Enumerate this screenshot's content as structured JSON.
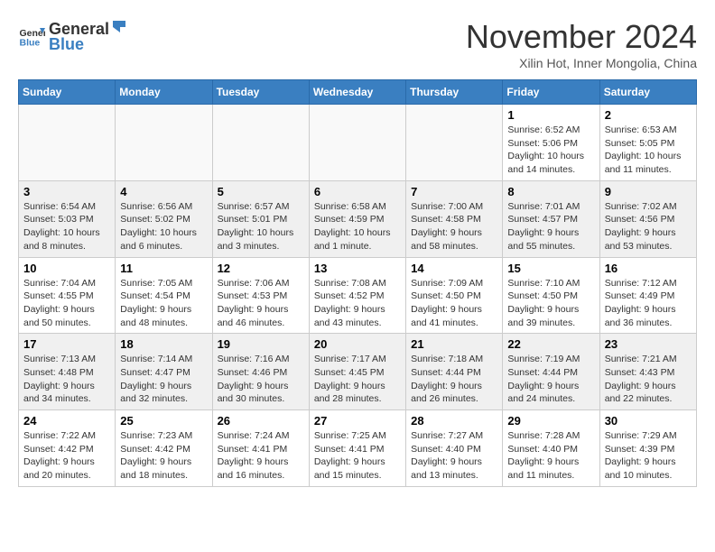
{
  "logo": {
    "text_general": "General",
    "text_blue": "Blue"
  },
  "title": "November 2024",
  "subtitle": "Xilin Hot, Inner Mongolia, China",
  "days_of_week": [
    "Sunday",
    "Monday",
    "Tuesday",
    "Wednesday",
    "Thursday",
    "Friday",
    "Saturday"
  ],
  "weeks": [
    [
      {
        "day": "",
        "info": ""
      },
      {
        "day": "",
        "info": ""
      },
      {
        "day": "",
        "info": ""
      },
      {
        "day": "",
        "info": ""
      },
      {
        "day": "",
        "info": ""
      },
      {
        "day": "1",
        "info": "Sunrise: 6:52 AM\nSunset: 5:06 PM\nDaylight: 10 hours and 14 minutes."
      },
      {
        "day": "2",
        "info": "Sunrise: 6:53 AM\nSunset: 5:05 PM\nDaylight: 10 hours and 11 minutes."
      }
    ],
    [
      {
        "day": "3",
        "info": "Sunrise: 6:54 AM\nSunset: 5:03 PM\nDaylight: 10 hours and 8 minutes."
      },
      {
        "day": "4",
        "info": "Sunrise: 6:56 AM\nSunset: 5:02 PM\nDaylight: 10 hours and 6 minutes."
      },
      {
        "day": "5",
        "info": "Sunrise: 6:57 AM\nSunset: 5:01 PM\nDaylight: 10 hours and 3 minutes."
      },
      {
        "day": "6",
        "info": "Sunrise: 6:58 AM\nSunset: 4:59 PM\nDaylight: 10 hours and 1 minute."
      },
      {
        "day": "7",
        "info": "Sunrise: 7:00 AM\nSunset: 4:58 PM\nDaylight: 9 hours and 58 minutes."
      },
      {
        "day": "8",
        "info": "Sunrise: 7:01 AM\nSunset: 4:57 PM\nDaylight: 9 hours and 55 minutes."
      },
      {
        "day": "9",
        "info": "Sunrise: 7:02 AM\nSunset: 4:56 PM\nDaylight: 9 hours and 53 minutes."
      }
    ],
    [
      {
        "day": "10",
        "info": "Sunrise: 7:04 AM\nSunset: 4:55 PM\nDaylight: 9 hours and 50 minutes."
      },
      {
        "day": "11",
        "info": "Sunrise: 7:05 AM\nSunset: 4:54 PM\nDaylight: 9 hours and 48 minutes."
      },
      {
        "day": "12",
        "info": "Sunrise: 7:06 AM\nSunset: 4:53 PM\nDaylight: 9 hours and 46 minutes."
      },
      {
        "day": "13",
        "info": "Sunrise: 7:08 AM\nSunset: 4:52 PM\nDaylight: 9 hours and 43 minutes."
      },
      {
        "day": "14",
        "info": "Sunrise: 7:09 AM\nSunset: 4:50 PM\nDaylight: 9 hours and 41 minutes."
      },
      {
        "day": "15",
        "info": "Sunrise: 7:10 AM\nSunset: 4:50 PM\nDaylight: 9 hours and 39 minutes."
      },
      {
        "day": "16",
        "info": "Sunrise: 7:12 AM\nSunset: 4:49 PM\nDaylight: 9 hours and 36 minutes."
      }
    ],
    [
      {
        "day": "17",
        "info": "Sunrise: 7:13 AM\nSunset: 4:48 PM\nDaylight: 9 hours and 34 minutes."
      },
      {
        "day": "18",
        "info": "Sunrise: 7:14 AM\nSunset: 4:47 PM\nDaylight: 9 hours and 32 minutes."
      },
      {
        "day": "19",
        "info": "Sunrise: 7:16 AM\nSunset: 4:46 PM\nDaylight: 9 hours and 30 minutes."
      },
      {
        "day": "20",
        "info": "Sunrise: 7:17 AM\nSunset: 4:45 PM\nDaylight: 9 hours and 28 minutes."
      },
      {
        "day": "21",
        "info": "Sunrise: 7:18 AM\nSunset: 4:44 PM\nDaylight: 9 hours and 26 minutes."
      },
      {
        "day": "22",
        "info": "Sunrise: 7:19 AM\nSunset: 4:44 PM\nDaylight: 9 hours and 24 minutes."
      },
      {
        "day": "23",
        "info": "Sunrise: 7:21 AM\nSunset: 4:43 PM\nDaylight: 9 hours and 22 minutes."
      }
    ],
    [
      {
        "day": "24",
        "info": "Sunrise: 7:22 AM\nSunset: 4:42 PM\nDaylight: 9 hours and 20 minutes."
      },
      {
        "day": "25",
        "info": "Sunrise: 7:23 AM\nSunset: 4:42 PM\nDaylight: 9 hours and 18 minutes."
      },
      {
        "day": "26",
        "info": "Sunrise: 7:24 AM\nSunset: 4:41 PM\nDaylight: 9 hours and 16 minutes."
      },
      {
        "day": "27",
        "info": "Sunrise: 7:25 AM\nSunset: 4:41 PM\nDaylight: 9 hours and 15 minutes."
      },
      {
        "day": "28",
        "info": "Sunrise: 7:27 AM\nSunset: 4:40 PM\nDaylight: 9 hours and 13 minutes."
      },
      {
        "day": "29",
        "info": "Sunrise: 7:28 AM\nSunset: 4:40 PM\nDaylight: 9 hours and 11 minutes."
      },
      {
        "day": "30",
        "info": "Sunrise: 7:29 AM\nSunset: 4:39 PM\nDaylight: 9 hours and 10 minutes."
      }
    ]
  ]
}
